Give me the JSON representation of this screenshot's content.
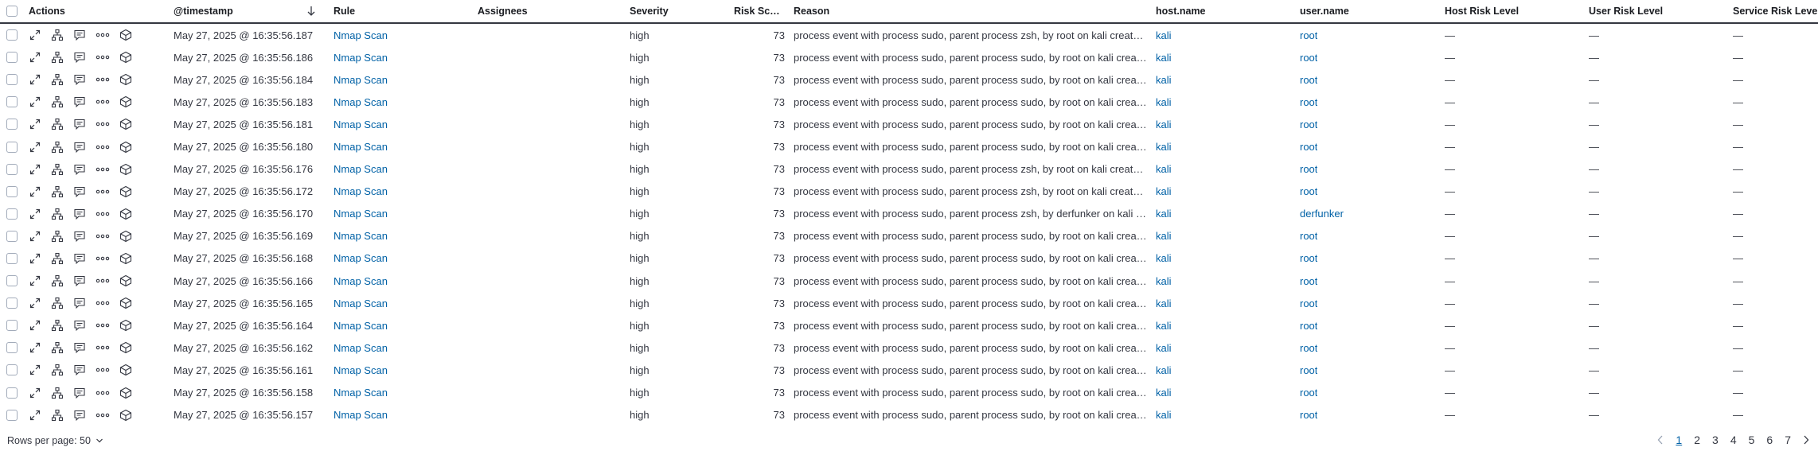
{
  "columns": {
    "actions": "Actions",
    "timestamp": "@timestamp",
    "rule": "Rule",
    "assignees": "Assignees",
    "severity": "Severity",
    "risk_score": "Risk Score",
    "reason": "Reason",
    "host_name": "host.name",
    "user_name": "user.name",
    "host_risk": "Host Risk Level",
    "user_risk": "User Risk Level",
    "service_risk": "Service Risk Leve"
  },
  "rows": [
    {
      "timestamp": "May 27, 2025 @ 16:35:56.187",
      "rule": "Nmap Scan",
      "severity": "high",
      "risk_score": "73",
      "reason": "process event with process sudo, parent process zsh, by root on kali create…",
      "host": "kali",
      "user": "root",
      "host_risk": "—",
      "user_risk": "—",
      "service_risk": "—"
    },
    {
      "timestamp": "May 27, 2025 @ 16:35:56.186",
      "rule": "Nmap Scan",
      "severity": "high",
      "risk_score": "73",
      "reason": "process event with process sudo, parent process sudo, by root on kali crea…",
      "host": "kali",
      "user": "root",
      "host_risk": "—",
      "user_risk": "—",
      "service_risk": "—"
    },
    {
      "timestamp": "May 27, 2025 @ 16:35:56.184",
      "rule": "Nmap Scan",
      "severity": "high",
      "risk_score": "73",
      "reason": "process event with process sudo, parent process sudo, by root on kali crea…",
      "host": "kali",
      "user": "root",
      "host_risk": "—",
      "user_risk": "—",
      "service_risk": "—"
    },
    {
      "timestamp": "May 27, 2025 @ 16:35:56.183",
      "rule": "Nmap Scan",
      "severity": "high",
      "risk_score": "73",
      "reason": "process event with process sudo, parent process sudo, by root on kali crea…",
      "host": "kali",
      "user": "root",
      "host_risk": "—",
      "user_risk": "—",
      "service_risk": "—"
    },
    {
      "timestamp": "May 27, 2025 @ 16:35:56.181",
      "rule": "Nmap Scan",
      "severity": "high",
      "risk_score": "73",
      "reason": "process event with process sudo, parent process sudo, by root on kali crea…",
      "host": "kali",
      "user": "root",
      "host_risk": "—",
      "user_risk": "—",
      "service_risk": "—"
    },
    {
      "timestamp": "May 27, 2025 @ 16:35:56.180",
      "rule": "Nmap Scan",
      "severity": "high",
      "risk_score": "73",
      "reason": "process event with process sudo, parent process sudo, by root on kali crea…",
      "host": "kali",
      "user": "root",
      "host_risk": "—",
      "user_risk": "—",
      "service_risk": "—"
    },
    {
      "timestamp": "May 27, 2025 @ 16:35:56.176",
      "rule": "Nmap Scan",
      "severity": "high",
      "risk_score": "73",
      "reason": "process event with process sudo, parent process zsh, by root on kali create…",
      "host": "kali",
      "user": "root",
      "host_risk": "—",
      "user_risk": "—",
      "service_risk": "—"
    },
    {
      "timestamp": "May 27, 2025 @ 16:35:56.172",
      "rule": "Nmap Scan",
      "severity": "high",
      "risk_score": "73",
      "reason": "process event with process sudo, parent process zsh, by root on kali create…",
      "host": "kali",
      "user": "root",
      "host_risk": "—",
      "user_risk": "—",
      "service_risk": "—"
    },
    {
      "timestamp": "May 27, 2025 @ 16:35:56.170",
      "rule": "Nmap Scan",
      "severity": "high",
      "risk_score": "73",
      "reason": "process event with process sudo, parent process zsh, by derfunker on kali …",
      "host": "kali",
      "user": "derfunker",
      "host_risk": "—",
      "user_risk": "—",
      "service_risk": "—"
    },
    {
      "timestamp": "May 27, 2025 @ 16:35:56.169",
      "rule": "Nmap Scan",
      "severity": "high",
      "risk_score": "73",
      "reason": "process event with process sudo, parent process sudo, by root on kali crea…",
      "host": "kali",
      "user": "root",
      "host_risk": "—",
      "user_risk": "—",
      "service_risk": "—"
    },
    {
      "timestamp": "May 27, 2025 @ 16:35:56.168",
      "rule": "Nmap Scan",
      "severity": "high",
      "risk_score": "73",
      "reason": "process event with process sudo, parent process sudo, by root on kali crea…",
      "host": "kali",
      "user": "root",
      "host_risk": "—",
      "user_risk": "—",
      "service_risk": "—"
    },
    {
      "timestamp": "May 27, 2025 @ 16:35:56.166",
      "rule": "Nmap Scan",
      "severity": "high",
      "risk_score": "73",
      "reason": "process event with process sudo, parent process sudo, by root on kali crea…",
      "host": "kali",
      "user": "root",
      "host_risk": "—",
      "user_risk": "—",
      "service_risk": "—"
    },
    {
      "timestamp": "May 27, 2025 @ 16:35:56.165",
      "rule": "Nmap Scan",
      "severity": "high",
      "risk_score": "73",
      "reason": "process event with process sudo, parent process sudo, by root on kali crea…",
      "host": "kali",
      "user": "root",
      "host_risk": "—",
      "user_risk": "—",
      "service_risk": "—"
    },
    {
      "timestamp": "May 27, 2025 @ 16:35:56.164",
      "rule": "Nmap Scan",
      "severity": "high",
      "risk_score": "73",
      "reason": "process event with process sudo, parent process sudo, by root on kali crea…",
      "host": "kali",
      "user": "root",
      "host_risk": "—",
      "user_risk": "—",
      "service_risk": "—"
    },
    {
      "timestamp": "May 27, 2025 @ 16:35:56.162",
      "rule": "Nmap Scan",
      "severity": "high",
      "risk_score": "73",
      "reason": "process event with process sudo, parent process sudo, by root on kali crea…",
      "host": "kali",
      "user": "root",
      "host_risk": "—",
      "user_risk": "—",
      "service_risk": "—"
    },
    {
      "timestamp": "May 27, 2025 @ 16:35:56.161",
      "rule": "Nmap Scan",
      "severity": "high",
      "risk_score": "73",
      "reason": "process event with process sudo, parent process sudo, by root on kali crea…",
      "host": "kali",
      "user": "root",
      "host_risk": "—",
      "user_risk": "—",
      "service_risk": "—"
    },
    {
      "timestamp": "May 27, 2025 @ 16:35:56.158",
      "rule": "Nmap Scan",
      "severity": "high",
      "risk_score": "73",
      "reason": "process event with process sudo, parent process sudo, by root on kali crea…",
      "host": "kali",
      "user": "root",
      "host_risk": "—",
      "user_risk": "—",
      "service_risk": "—"
    },
    {
      "timestamp": "May 27, 2025 @ 16:35:56.157",
      "rule": "Nmap Scan",
      "severity": "high",
      "risk_score": "73",
      "reason": "process event with process sudo, parent process sudo, by root on kali crea…",
      "host": "kali",
      "user": "root",
      "host_risk": "—",
      "user_risk": "—",
      "service_risk": "—"
    }
  ],
  "row_action_icons": [
    "expand-icon",
    "analyze-tree-icon",
    "comment-icon",
    "more-actions-icon",
    "session-view-icon"
  ],
  "footer": {
    "rows_per_page": "Rows per page: 50",
    "pages": [
      "1",
      "2",
      "3",
      "4",
      "5",
      "6",
      "7"
    ],
    "active_page": "1"
  },
  "colors": {
    "link": "#0061a6",
    "text": "#343741",
    "border": "#343741"
  }
}
